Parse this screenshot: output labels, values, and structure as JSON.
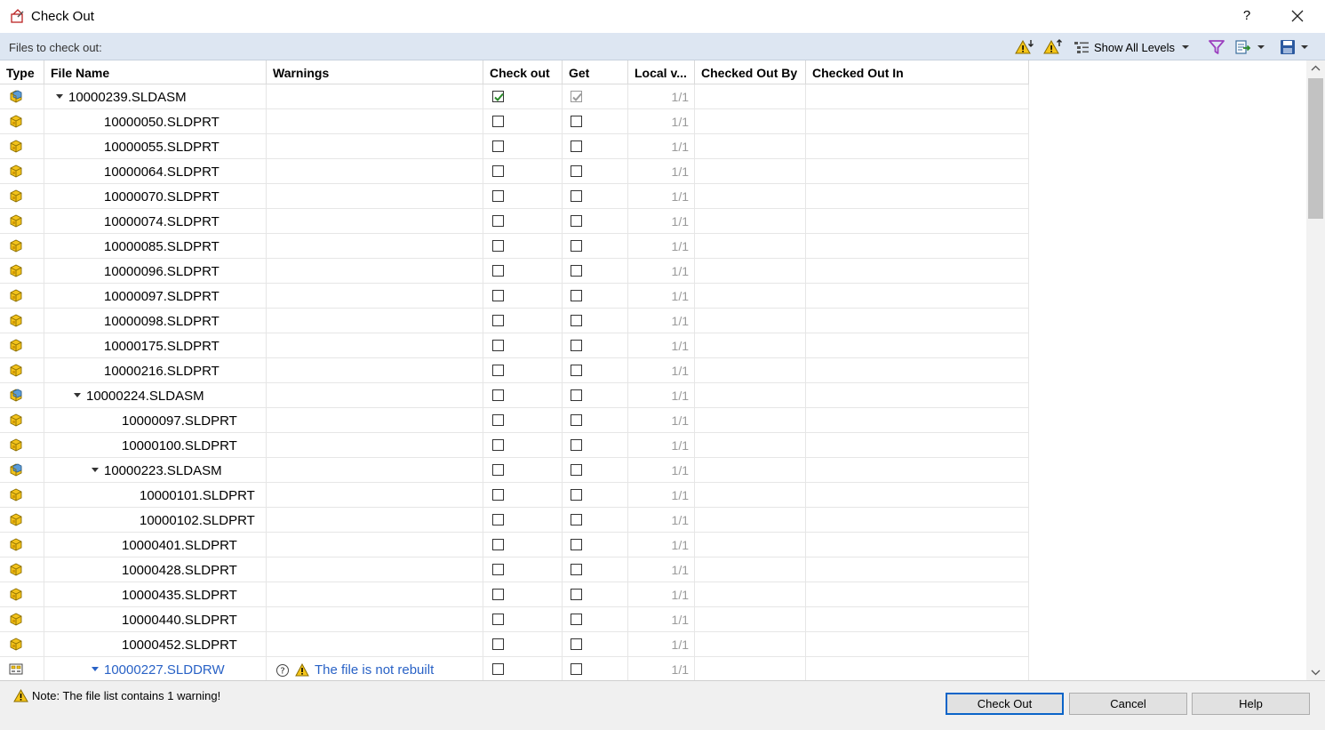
{
  "window": {
    "title": "Check Out",
    "help_label": "?"
  },
  "toolbar": {
    "files_label": "Files to check out:",
    "show_levels_label": "Show All Levels"
  },
  "columns": {
    "type": "Type",
    "file_name": "File Name",
    "warnings": "Warnings",
    "check_out": "Check out",
    "get": "Get",
    "local_version": "Local v...",
    "checked_out_by": "Checked Out By",
    "checked_out_in": "Checked Out In"
  },
  "rows": [
    {
      "name": "10000239.SLDASM",
      "kind": "asm",
      "level": 0,
      "expandable": true,
      "check_out": true,
      "get": true,
      "get_disabled": true,
      "local_version": "1/1",
      "warning": ""
    },
    {
      "name": "10000050.SLDPRT",
      "kind": "prt",
      "level": 1,
      "expandable": false,
      "check_out": false,
      "get": false,
      "local_version": "1/1",
      "warning": ""
    },
    {
      "name": "10000055.SLDPRT",
      "kind": "prt",
      "level": 1,
      "expandable": false,
      "check_out": false,
      "get": false,
      "local_version": "1/1",
      "warning": ""
    },
    {
      "name": "10000064.SLDPRT",
      "kind": "prt",
      "level": 1,
      "expandable": false,
      "check_out": false,
      "get": false,
      "local_version": "1/1",
      "warning": ""
    },
    {
      "name": "10000070.SLDPRT",
      "kind": "prt",
      "level": 1,
      "expandable": false,
      "check_out": false,
      "get": false,
      "local_version": "1/1",
      "warning": ""
    },
    {
      "name": "10000074.SLDPRT",
      "kind": "prt",
      "level": 1,
      "expandable": false,
      "check_out": false,
      "get": false,
      "local_version": "1/1",
      "warning": ""
    },
    {
      "name": "10000085.SLDPRT",
      "kind": "prt",
      "level": 1,
      "expandable": false,
      "check_out": false,
      "get": false,
      "local_version": "1/1",
      "warning": ""
    },
    {
      "name": "10000096.SLDPRT",
      "kind": "prt",
      "level": 1,
      "expandable": false,
      "check_out": false,
      "get": false,
      "local_version": "1/1",
      "warning": ""
    },
    {
      "name": "10000097.SLDPRT",
      "kind": "prt",
      "level": 1,
      "expandable": false,
      "check_out": false,
      "get": false,
      "local_version": "1/1",
      "warning": ""
    },
    {
      "name": "10000098.SLDPRT",
      "kind": "prt",
      "level": 1,
      "expandable": false,
      "check_out": false,
      "get": false,
      "local_version": "1/1",
      "warning": ""
    },
    {
      "name": "10000175.SLDPRT",
      "kind": "prt",
      "level": 1,
      "expandable": false,
      "check_out": false,
      "get": false,
      "local_version": "1/1",
      "warning": ""
    },
    {
      "name": "10000216.SLDPRT",
      "kind": "prt",
      "level": 1,
      "expandable": false,
      "check_out": false,
      "get": false,
      "local_version": "1/1",
      "warning": ""
    },
    {
      "name": "10000224.SLDASM",
      "kind": "asm",
      "level": 1,
      "expandable": true,
      "check_out": false,
      "get": false,
      "local_version": "1/1",
      "warning": ""
    },
    {
      "name": "10000097.SLDPRT",
      "kind": "prt",
      "level": 2,
      "expandable": false,
      "check_out": false,
      "get": false,
      "local_version": "1/1",
      "warning": ""
    },
    {
      "name": "10000100.SLDPRT",
      "kind": "prt",
      "level": 2,
      "expandable": false,
      "check_out": false,
      "get": false,
      "local_version": "1/1",
      "warning": ""
    },
    {
      "name": "10000223.SLDASM",
      "kind": "asm",
      "level": 2,
      "expandable": true,
      "check_out": false,
      "get": false,
      "local_version": "1/1",
      "warning": ""
    },
    {
      "name": "10000101.SLDPRT",
      "kind": "prt",
      "level": 3,
      "expandable": false,
      "check_out": false,
      "get": false,
      "local_version": "1/1",
      "warning": ""
    },
    {
      "name": "10000102.SLDPRT",
      "kind": "prt",
      "level": 3,
      "expandable": false,
      "check_out": false,
      "get": false,
      "local_version": "1/1",
      "warning": ""
    },
    {
      "name": "10000401.SLDPRT",
      "kind": "prt",
      "level": 2,
      "expandable": false,
      "check_out": false,
      "get": false,
      "local_version": "1/1",
      "warning": ""
    },
    {
      "name": "10000428.SLDPRT",
      "kind": "prt",
      "level": 2,
      "expandable": false,
      "check_out": false,
      "get": false,
      "local_version": "1/1",
      "warning": ""
    },
    {
      "name": "10000435.SLDPRT",
      "kind": "prt",
      "level": 2,
      "expandable": false,
      "check_out": false,
      "get": false,
      "local_version": "1/1",
      "warning": ""
    },
    {
      "name": "10000440.SLDPRT",
      "kind": "prt",
      "level": 2,
      "expandable": false,
      "check_out": false,
      "get": false,
      "local_version": "1/1",
      "warning": ""
    },
    {
      "name": "10000452.SLDPRT",
      "kind": "prt",
      "level": 2,
      "expandable": false,
      "check_out": false,
      "get": false,
      "local_version": "1/1",
      "warning": ""
    },
    {
      "name": "10000227.SLDDRW",
      "kind": "drw",
      "level": 2,
      "expandable": true,
      "check_out": false,
      "get": false,
      "local_version": "1/1",
      "warning": "The file is not rebuilt",
      "link": true
    }
  ],
  "footer": {
    "note": "Note: The file list contains 1 warning!",
    "check_out_label": "Check Out",
    "cancel_label": "Cancel",
    "help_label": "Help"
  },
  "colors": {
    "toolbar_bg": "#dde6f2",
    "link_blue": "#2962c6",
    "warning_yellow": "#f5c518",
    "check_green": "#2a8a2a",
    "filter_purple": "#9b3fbf"
  },
  "icons": {
    "window": "checkout-icon",
    "close": "close-icon",
    "warn_down": "warning-down-icon",
    "warn_up": "warning-up-icon",
    "levels": "tree-levels-icon",
    "filter": "filter-icon",
    "export": "export-icon",
    "save": "save-icon",
    "part": "part-icon",
    "assembly": "assembly-icon",
    "drawing": "drawing-icon",
    "question": "question-icon",
    "warning": "warning-icon"
  }
}
